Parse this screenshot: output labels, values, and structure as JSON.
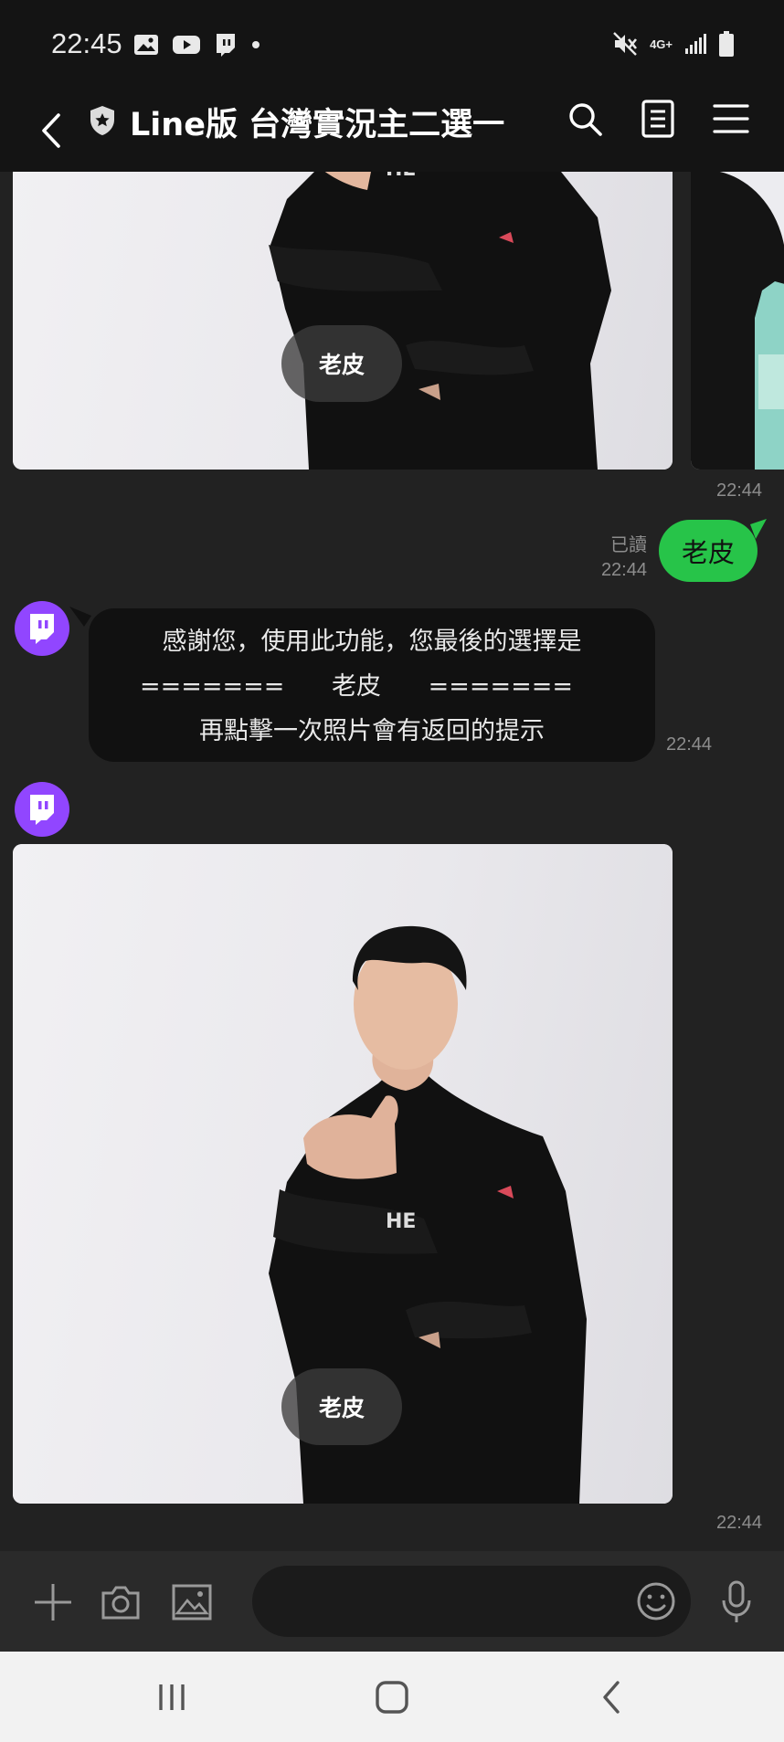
{
  "status_bar": {
    "time": "22:45",
    "network": "4G+",
    "icons_left": [
      "gallery-icon",
      "youtube-icon",
      "twitch-icon",
      "dot-icon"
    ],
    "icons_right": [
      "mute-icon",
      "network-4g-icon",
      "signal-icon",
      "battery-icon"
    ]
  },
  "header": {
    "title": "Line版 台灣實況主二選一",
    "icons": [
      "back-icon",
      "shield-icon",
      "search-icon",
      "notes-icon",
      "menu-icon"
    ]
  },
  "messages": {
    "top_photo_caption": "老皮",
    "top_photo_time": "22:44",
    "sent": {
      "read_label": "已讀",
      "time": "22:44",
      "text": "老皮"
    },
    "bot_reply": {
      "line1": "感謝您，使用此功能，您最後的選擇是",
      "line2_left": "=======",
      "line2_mid": "老皮",
      "line2_right": "=======",
      "line3": "再點擊一次照片會有返回的提示",
      "time": "22:44"
    },
    "bottom_photo_caption": "老皮",
    "bottom_photo_time": "22:44"
  },
  "input_bar": {
    "placeholder": "",
    "icons": [
      "plus-icon",
      "camera-icon",
      "image-icon",
      "emoji-icon",
      "mic-icon"
    ]
  },
  "nav_bar": {
    "icons": [
      "recent-apps-icon",
      "home-icon",
      "back-nav-icon"
    ]
  },
  "colors": {
    "background": "#222222",
    "bar": "#141414",
    "sent_bubble": "#27c449",
    "received_bubble": "#111111",
    "twitch_purple": "#9146ff"
  }
}
